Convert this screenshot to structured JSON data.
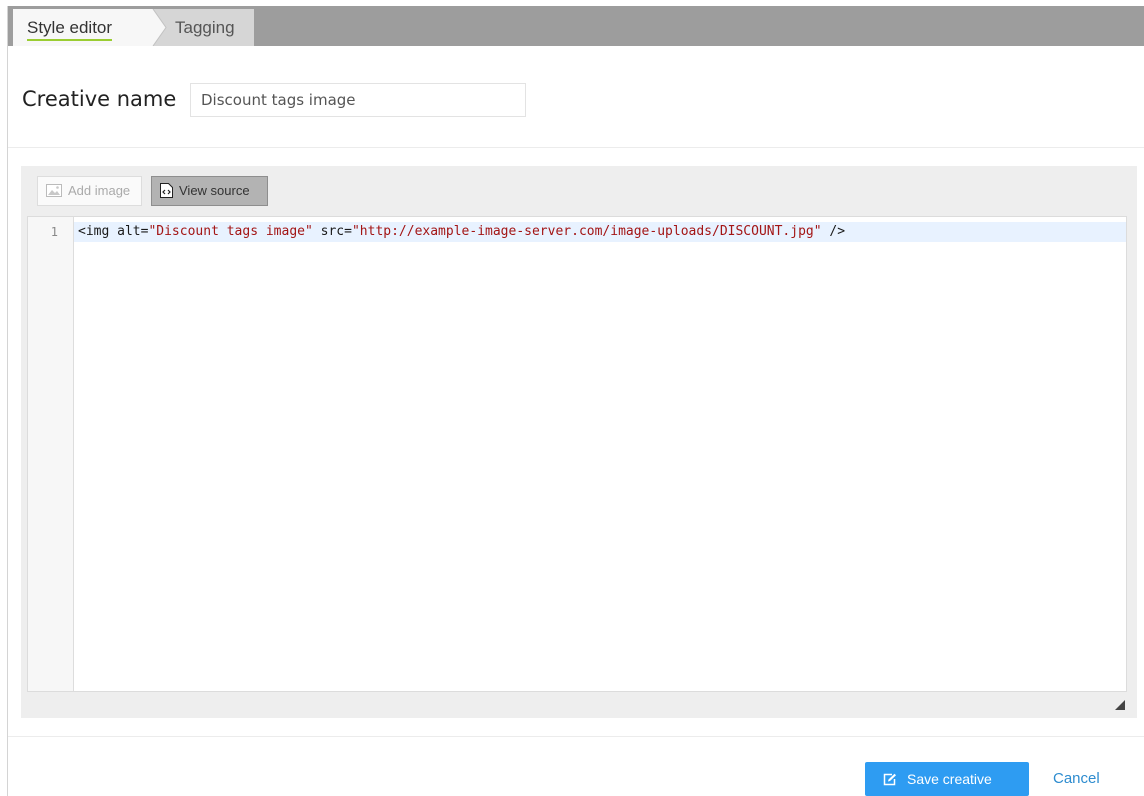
{
  "tabs": {
    "style_editor": "Style editor",
    "tagging": "Tagging"
  },
  "creative": {
    "name_label": "Creative name",
    "name_value": "Discount tags image"
  },
  "toolbar": {
    "add_image_label": "Add image",
    "view_source_label": "View source",
    "add_image_icon": "image-icon",
    "view_source_icon": "source-code-icon"
  },
  "editor": {
    "line_number": "1",
    "tok_open": "<img ",
    "tok_alt_attr": "alt=",
    "tok_alt_value": "\"Discount tags image\"",
    "tok_src_attr": " src=",
    "tok_src_value": "\"http://example-image-server.com/image-uploads/DISCOUNT.jpg\"",
    "tok_close": " />"
  },
  "footer": {
    "save_label": "Save creative",
    "save_icon": "edit-icon",
    "cancel_label": "Cancel"
  },
  "colors": {
    "accent": "#2e9cf2",
    "tab_underline": "#9acd32",
    "string_token": "#a31515"
  }
}
